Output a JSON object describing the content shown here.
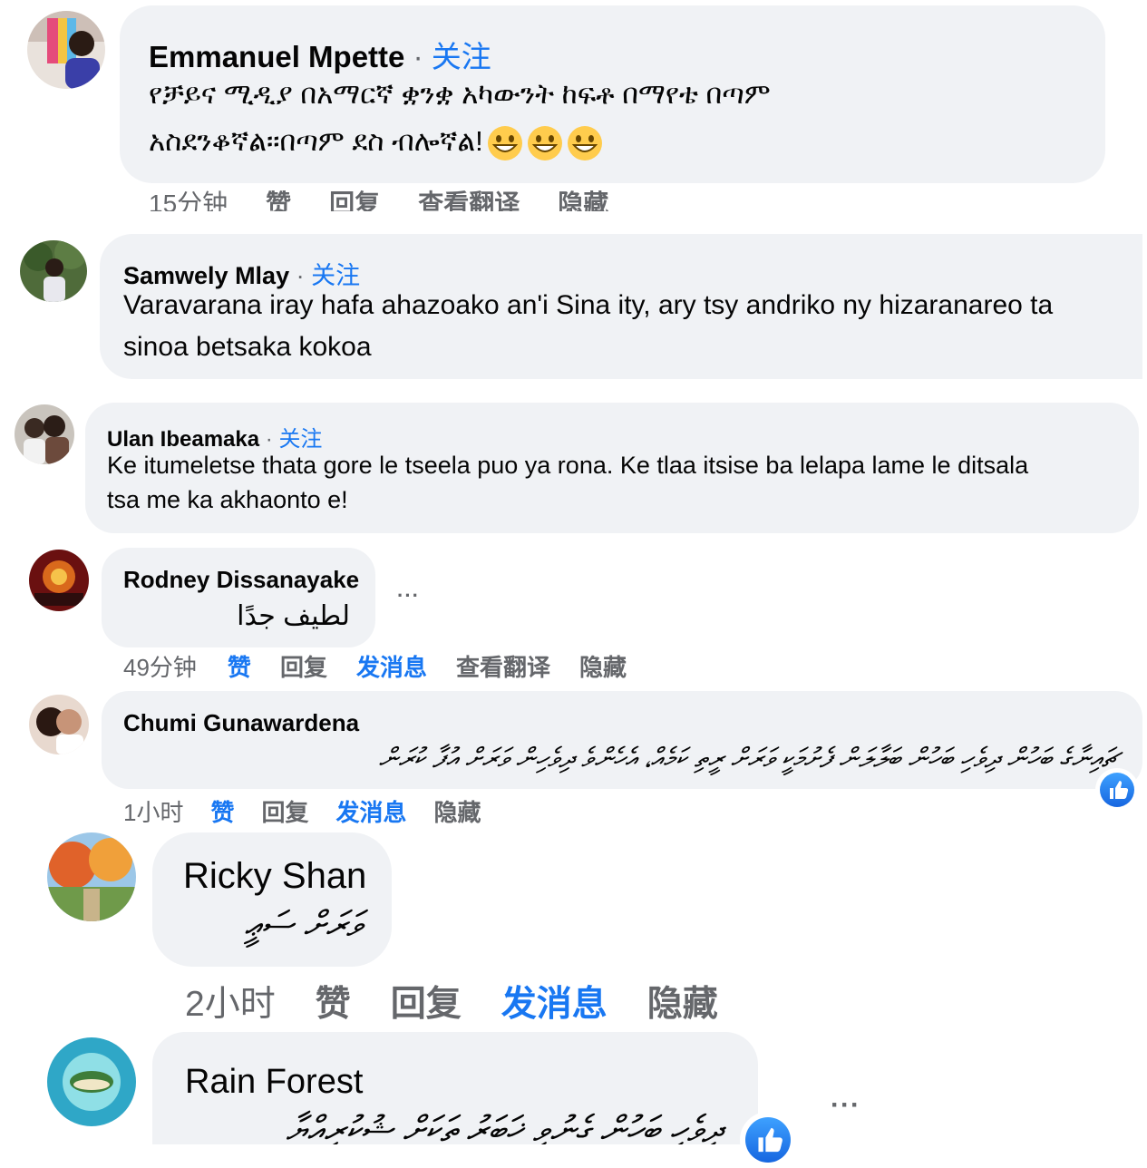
{
  "ui": {
    "dot": "·",
    "follow": "关注",
    "more": "···",
    "emoji_name": "grinning-face-emoji",
    "colors": {
      "bubble": "#f0f2f5",
      "link": "#1877f2",
      "meta": "#65676b"
    }
  },
  "comments": [
    {
      "author": "Emmanuel Mpette",
      "follow": "关注",
      "text_line1": "የቻይና ሚዲያ በአማርኛ ቋንቋ አካውንት ከፍቶ በማየቴ በጣም",
      "text_line2": "አስደንቆኛል።በጣም ደስ ብሎኛል!",
      "emoji_count": 3,
      "actions": [
        "15分钟",
        "赞",
        "回复",
        "查看翻译",
        "隐藏"
      ]
    },
    {
      "author": "Samwely Mlay",
      "follow": "关注",
      "text_line1": "Varavarana iray hafa ahazoako an'i Sina ity, ary tsy andriko ny hizaranareo ta",
      "text_line2": "sinoa betsaka kokoa"
    },
    {
      "author": "Ulan Ibeamaka",
      "follow": "关注",
      "text_line1": "Ke itumeletse thata gore le tseela puo ya rona. Ke tlaa itsise ba lelapa lame le ditsala",
      "text_line2": "tsa me ka akhaonto e!"
    },
    {
      "author": "Rodney Dissanayake",
      "text_line1": "لطيف جدًا",
      "actions": [
        "49分钟",
        "赞",
        "回复",
        "发消息",
        "查看翻译",
        "隐藏"
      ]
    },
    {
      "author": "Chumi Gunawardena",
      "text_line1": "ޗައިނާގެ ބަހުން ދިވެހި ބަހުން ބަލާލަން ފެށުމަކީ ވަރަށް ރީތި ކަމެއް، އެހެންވެ ދިވެހިން ވަރަށް އުފާ ކުރަން",
      "actions": [
        "1小时",
        "赞",
        "回复",
        "发消息",
        "隐藏"
      ]
    },
    {
      "author": "Ricky Shan",
      "text_line1": "ވަރަށް ސަޢީ",
      "actions": [
        "2小时",
        "赞",
        "回复",
        "发消息",
        "隐藏"
      ]
    },
    {
      "author": "Rain Forest",
      "text_line1": "ދިވެހި ބަހުން ގެނުވި ޚަބަރު ތަކަށް ޝުކުރިއްޔާ"
    }
  ]
}
